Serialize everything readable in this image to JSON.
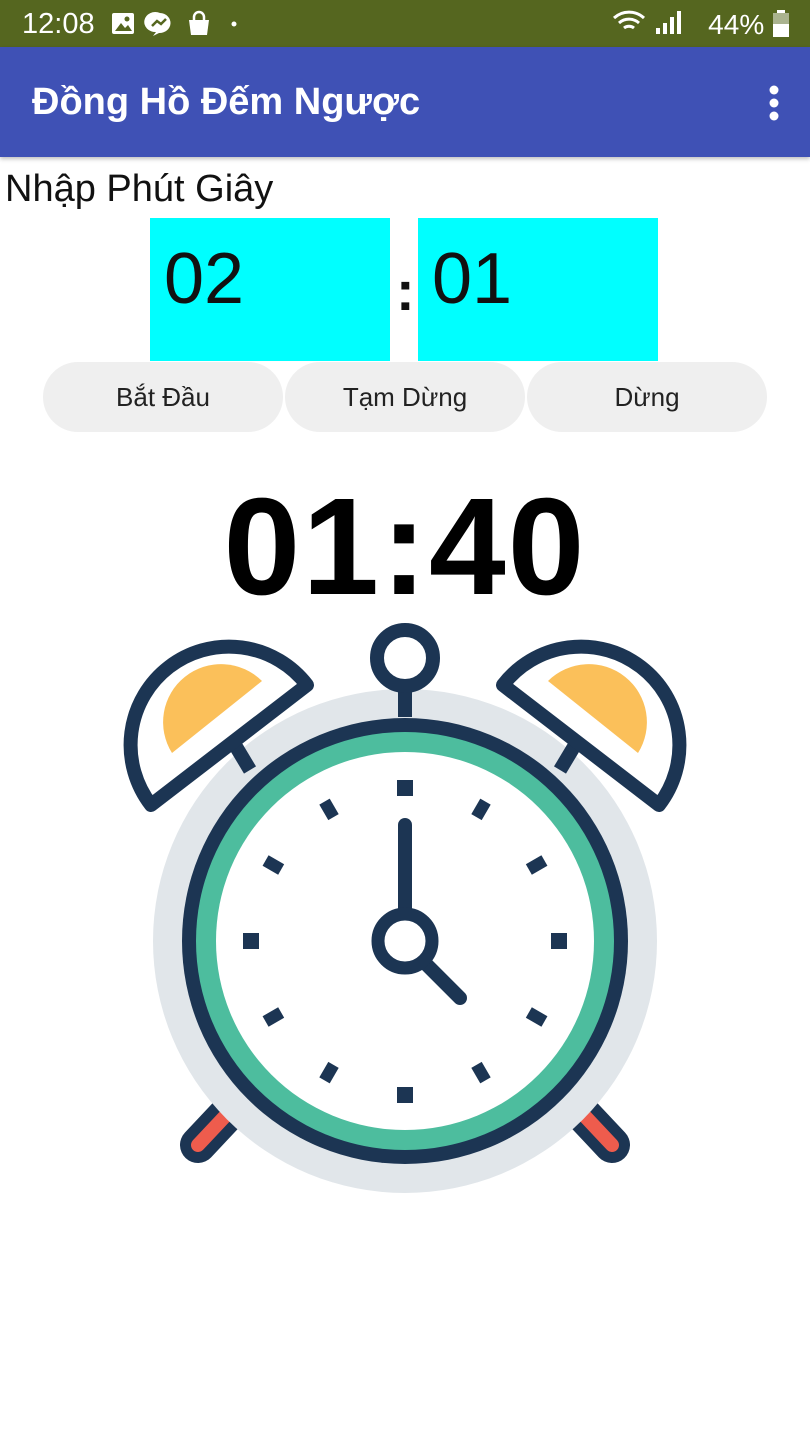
{
  "status_bar": {
    "time": "12:08",
    "battery": "44%"
  },
  "app_bar": {
    "title": "Đồng Hồ Đếm Ngược",
    "menu_icon": "more-vert-icon"
  },
  "input": {
    "label": "Nhập Phút Giây",
    "minutes": "02",
    "separator": ":",
    "seconds": "01"
  },
  "buttons": {
    "start": "Bắt Đầu",
    "pause": "Tạm Dừng",
    "stop": "Dừng"
  },
  "countdown": {
    "display": "01:40"
  },
  "colors": {
    "status_bar": "#55661f",
    "app_bar": "#3f51b5",
    "input_bg": "#00ffff",
    "button_bg": "#efefef",
    "clock_outline": "#1c3553",
    "clock_ring": "#4dbd9e",
    "bell_fill": "#fbc05a",
    "feet": "#ee5c4d"
  }
}
